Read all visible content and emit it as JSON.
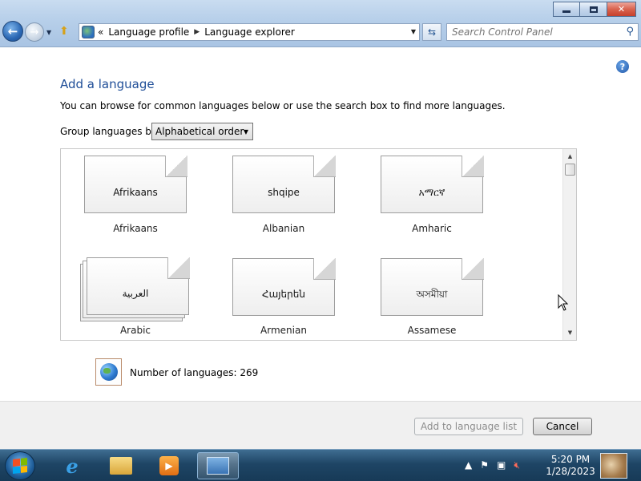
{
  "window": {
    "breadcrumb": [
      "Language profile",
      "Language explorer"
    ],
    "breadcrumb_prefix": "«",
    "search_placeholder": "Search Control Panel"
  },
  "content": {
    "help": "?",
    "title": "Add a language",
    "description": "You can browse for common languages below or use the search box to find more languages.",
    "group_label": "Group languages by:",
    "group_value": "Alphabetical order",
    "languages": [
      {
        "name": "Afrikaans",
        "native": "Afrikaans",
        "stacked": false
      },
      {
        "name": "Albanian",
        "native": "shqipe",
        "stacked": false
      },
      {
        "name": "Amharic",
        "native": "አማርኛ",
        "stacked": false
      },
      {
        "name": "Arabic",
        "native": "العربية",
        "stacked": true
      },
      {
        "name": "Armenian",
        "native": "Հայերեն",
        "stacked": false
      },
      {
        "name": "Assamese",
        "native": "অসমীয়া",
        "stacked": false
      }
    ],
    "count_text": "Number of languages: 269"
  },
  "footer": {
    "add_label": "Add to language list",
    "cancel_label": "Cancel"
  },
  "taskbar": {
    "time": "5:20 PM",
    "date": "1/28/2023"
  },
  "colors": {
    "title": "#1e4d97",
    "taskbar": "#1e4565"
  }
}
